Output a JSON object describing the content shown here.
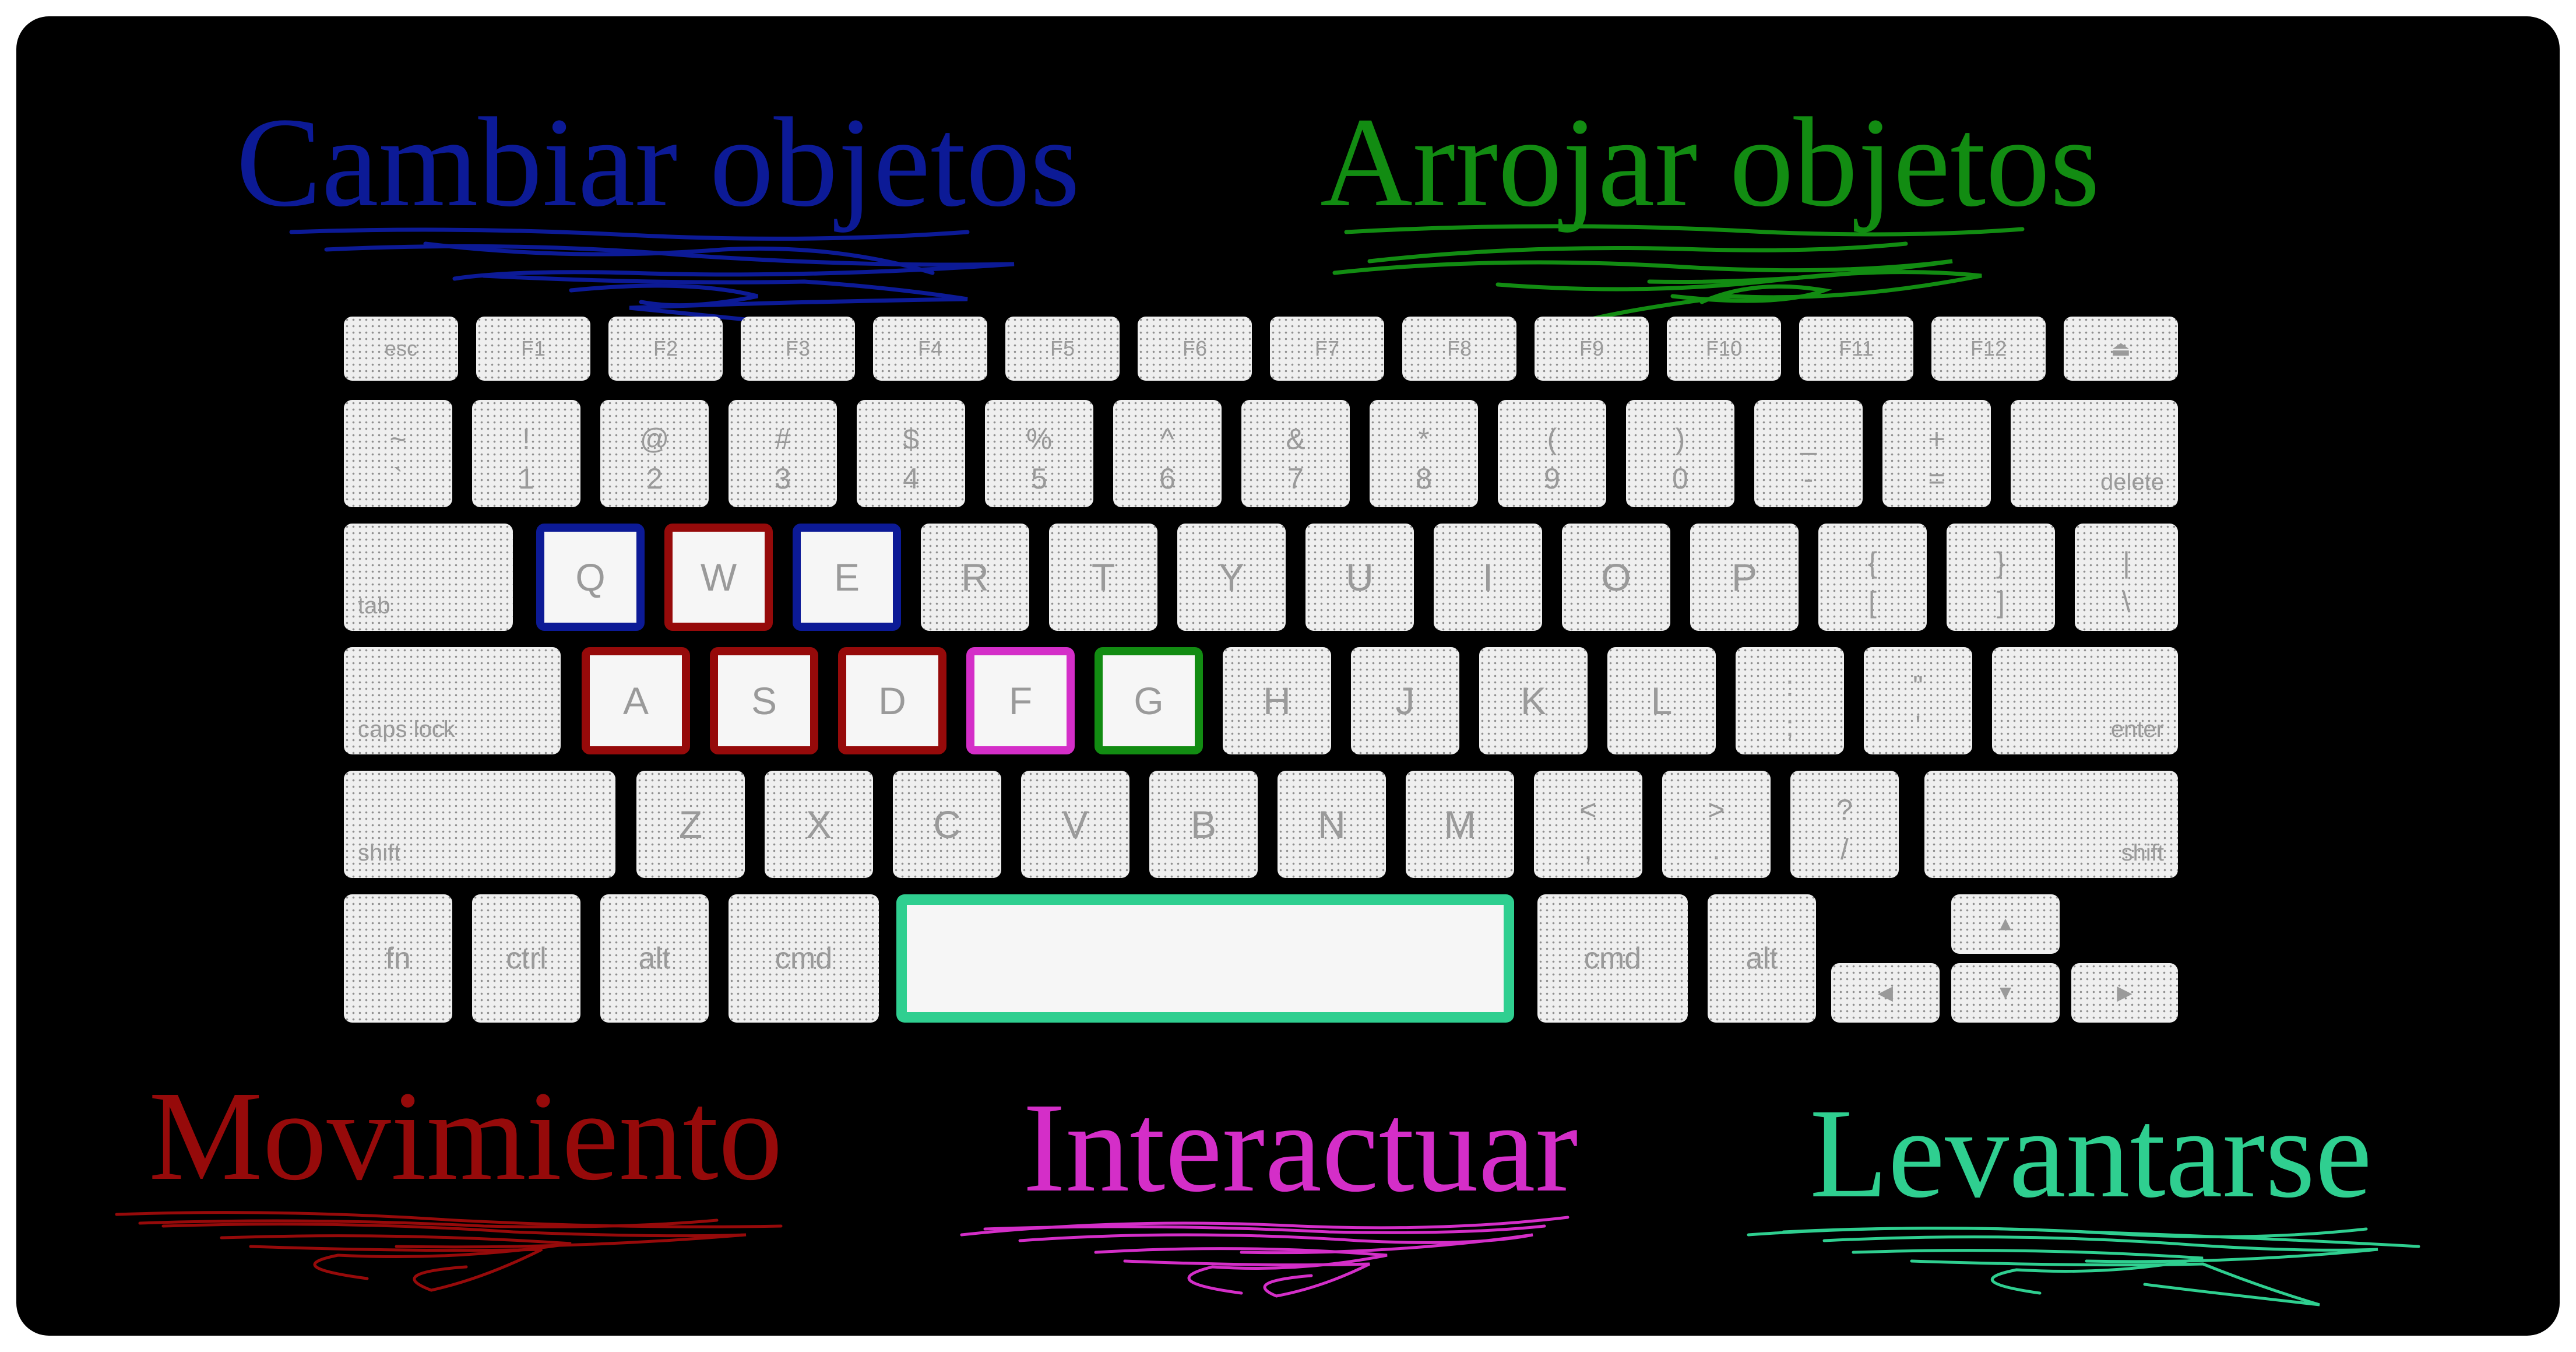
{
  "captions": {
    "swap": "Cambiar objetos",
    "throw": "Arrojar objetos",
    "move": "Movimiento",
    "interact": "Interactuar",
    "stand": "Levantarse"
  },
  "colors": {
    "swap": "#0c1a96",
    "throw": "#128c12",
    "move": "#960a0a",
    "interact": "#d42ec8",
    "stand": "#2fcf90"
  },
  "keys": {
    "esc": "esc",
    "f1": "F1",
    "f2": "F2",
    "f3": "F3",
    "f4": "F4",
    "f5": "F5",
    "f6": "F6",
    "f7": "F7",
    "f8": "F8",
    "f9": "F9",
    "f10": "F10",
    "f11": "F11",
    "f12": "F12",
    "eject": "⏏",
    "tilde_top": "~",
    "tilde_bot": "`",
    "n1_top": "!",
    "n1": "1",
    "n2_top": "@",
    "n2": "2",
    "n3_top": "#",
    "n3": "3",
    "n4_top": "$",
    "n4": "4",
    "n5_top": "%",
    "n5": "5",
    "n6_top": "^",
    "n6": "6",
    "n7_top": "&",
    "n7": "7",
    "n8_top": "*",
    "n8": "8",
    "n9_top": "(",
    "n9": "9",
    "n0_top": ")",
    "n0": "0",
    "minus_top": "_",
    "minus": "-",
    "plus_top": "+",
    "plus": "=",
    "delete": "delete",
    "tab": "tab",
    "q": "Q",
    "w": "W",
    "e": "E",
    "r": "R",
    "t": "T",
    "y": "Y",
    "u": "U",
    "i": "I",
    "o": "O",
    "p": "P",
    "lbr_top": "{",
    "lbr": "[",
    "rbr_top": "}",
    "rbr": "]",
    "bsl_top": "|",
    "bsl": "\\",
    "caps": "caps lock",
    "a": "A",
    "s": "S",
    "d": "D",
    "f": "F",
    "g": "G",
    "h": "H",
    "j": "J",
    "k": "K",
    "l": "L",
    "semi_top": ":",
    "semi": ";",
    "quote_top": "\"",
    "quote": "'",
    "enter": "enter",
    "shift": "shift",
    "z": "Z",
    "x": "X",
    "c": "C",
    "v": "V",
    "b": "B",
    "n": "N",
    "m": "M",
    "comma_top": "<",
    "comma": ",",
    "dot_top": ">",
    "dot": ".",
    "slash_top": "?",
    "slash": "/",
    "fn": "fn",
    "ctrl": "ctrl",
    "alt": "alt",
    "cmd": "cmd",
    "arrow_up": "▲",
    "arrow_down": "▼",
    "arrow_left": "◀",
    "arrow_right": "▶"
  }
}
